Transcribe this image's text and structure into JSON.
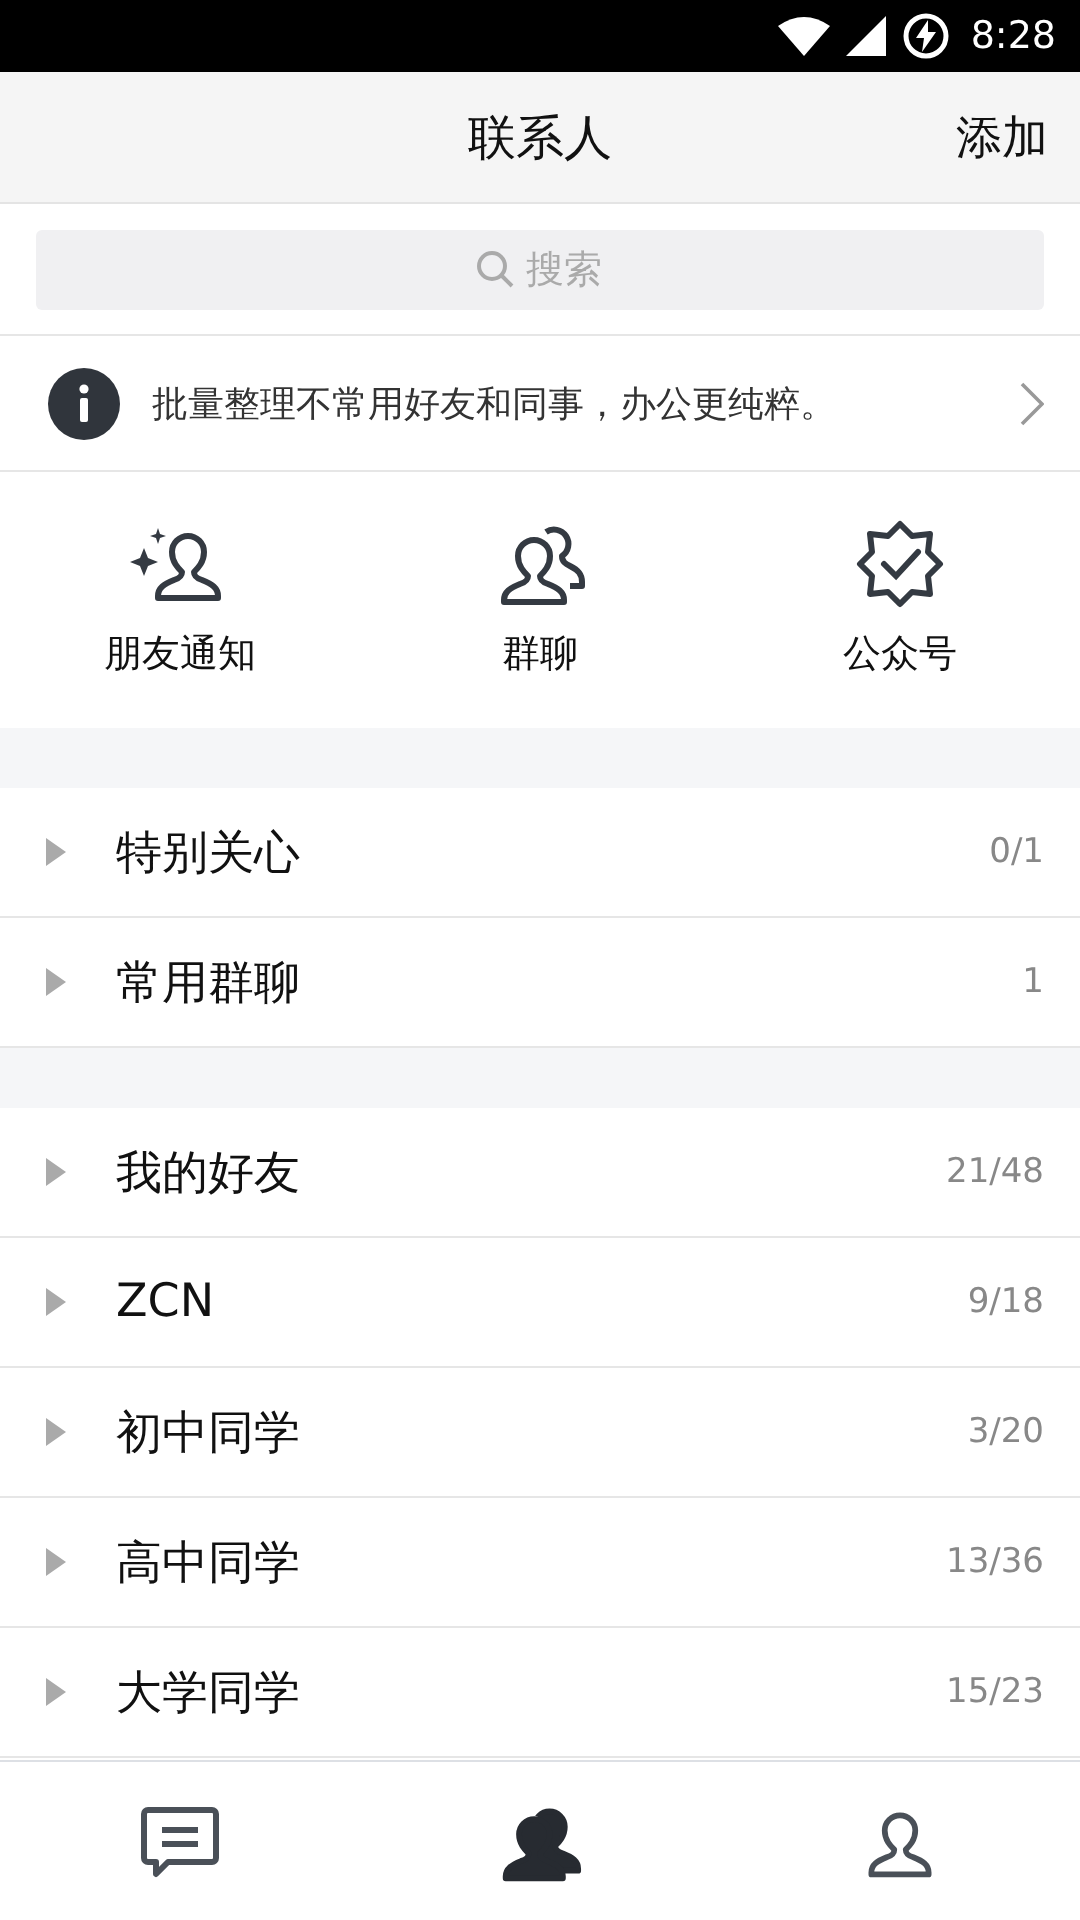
{
  "status_bar": {
    "time": "8:28"
  },
  "header": {
    "title": "联系人",
    "action": "添加"
  },
  "search": {
    "placeholder": "搜索"
  },
  "notice": {
    "text": "批量整理不常用好友和同事，办公更纯粹。"
  },
  "shortcuts": [
    {
      "kind": "notify",
      "label": "朋友通知"
    },
    {
      "kind": "group",
      "label": "群聊"
    },
    {
      "kind": "official",
      "label": "公众号"
    }
  ],
  "sections": [
    [
      {
        "name": "特别关心",
        "count": "0/1",
        "expanded": false
      },
      {
        "name": "常用群聊",
        "count": "1",
        "expanded": false
      }
    ],
    [
      {
        "name": "我的好友",
        "count": "21/48",
        "expanded": false
      },
      {
        "name": "ZCN",
        "count": "9/18",
        "expanded": false
      },
      {
        "name": "初中同学",
        "count": "3/20",
        "expanded": false
      },
      {
        "name": "高中同学",
        "count": "13/36",
        "expanded": false
      },
      {
        "name": "大学同学",
        "count": "15/23",
        "expanded": false
      }
    ]
  ],
  "bottom_nav": [
    {
      "kind": "messages",
      "selected": false
    },
    {
      "kind": "contacts",
      "selected": true
    },
    {
      "kind": "profile",
      "selected": false
    }
  ]
}
